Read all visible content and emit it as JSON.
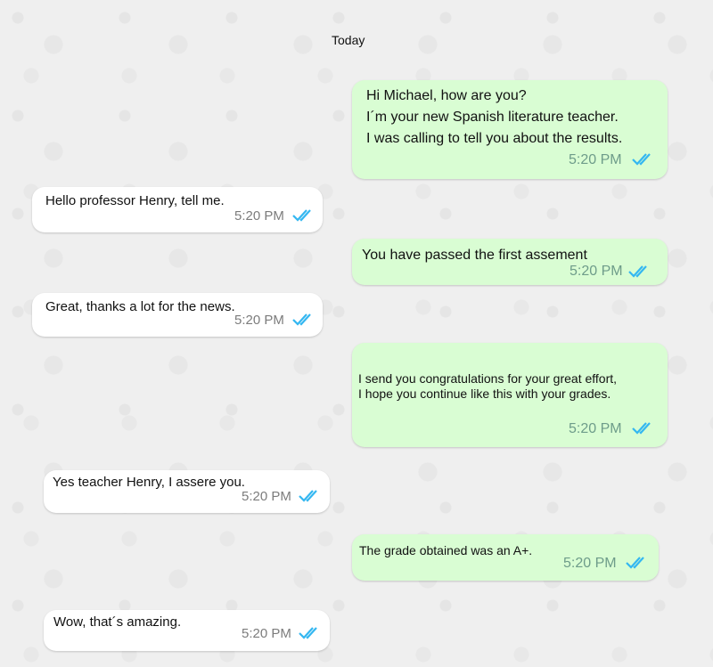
{
  "chat": {
    "date_label": "Today",
    "tick_icon": "double-check-icon",
    "colors": {
      "outgoing": "#d9fdd3",
      "incoming": "#ffffff",
      "tick": "#34b7f1"
    },
    "messages": [
      {
        "direction": "out",
        "lines": [
          "Hi Michael, how are you?",
          "I´m your new Spanish literature teacher.",
          "I was calling to tell you about the results."
        ],
        "time": "5:20 PM"
      },
      {
        "direction": "in",
        "lines": [
          "Hello professor Henry, tell me."
        ],
        "time": "5:20 PM"
      },
      {
        "direction": "out",
        "lines": [
          "You have passed the first assement"
        ],
        "time": "5:20 PM"
      },
      {
        "direction": "in",
        "lines": [
          "Great, thanks a lot for the news."
        ],
        "time": "5:20 PM"
      },
      {
        "direction": "out",
        "lines": [
          "I send you congratulations for your great effort,",
          "I hope you continue like this with your grades."
        ],
        "time": "5:20 PM"
      },
      {
        "direction": "in",
        "lines": [
          "Yes teacher Henry, I assere you."
        ],
        "time": "5:20 PM"
      },
      {
        "direction": "out",
        "lines": [
          "The grade obtained was an A+."
        ],
        "time": "5:20 PM"
      },
      {
        "direction": "in",
        "lines": [
          "Wow, that´s amazing."
        ],
        "time": "5:20 PM"
      }
    ]
  }
}
